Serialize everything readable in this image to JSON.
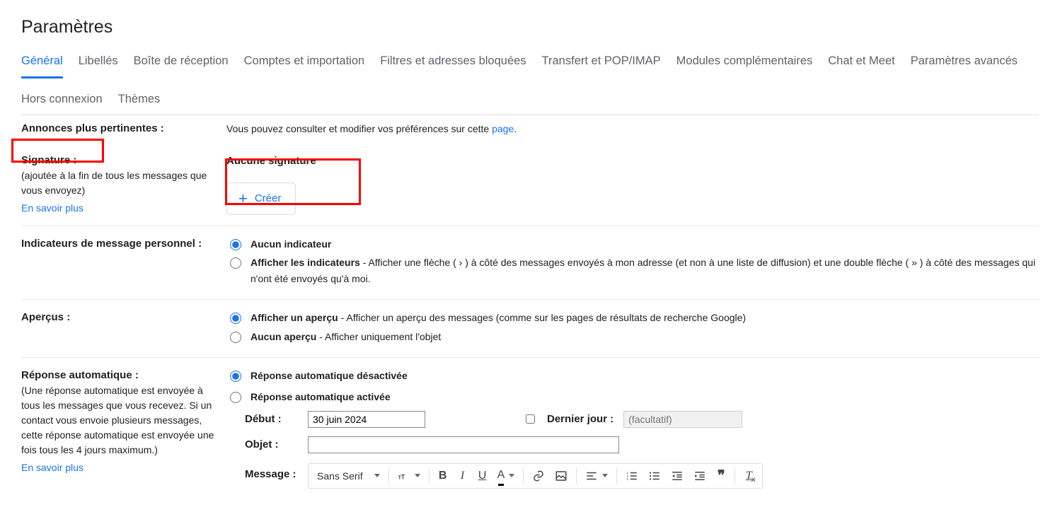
{
  "pageTitle": "Paramètres",
  "tabs": [
    "Général",
    "Libellés",
    "Boîte de réception",
    "Comptes et importation",
    "Filtres et adresses bloquées",
    "Transfert et POP/IMAP",
    "Modules complémentaires",
    "Chat et Meet",
    "Paramètres avancés",
    "Hors connexion",
    "Thèmes"
  ],
  "activeTabIndex": 0,
  "ads": {
    "label": "Annonces plus pertinentes :",
    "text": "Vous pouvez consulter et modifier vos préférences sur cette ",
    "link": "page",
    "suffix": "."
  },
  "signature": {
    "label": "Signature :",
    "desc": "(ajoutée à la fin de tous les messages que vous envoyez)",
    "learnMore": "En savoir plus",
    "none": "Aucune signature",
    "createBtn": "Créer"
  },
  "indicators": {
    "label": "Indicateurs de message personnel :",
    "opt1": "Aucun indicateur",
    "opt2bold": "Afficher les indicateurs",
    "opt2text": " - Afficher une flèche ( › ) à côté des messages envoyés à mon adresse (et non à une liste de diffusion) et une double flèche ( » ) à côté des messages qui n'ont été envoyés qu'à moi."
  },
  "snippets": {
    "label": "Aperçus :",
    "opt1bold": "Afficher un aperçu",
    "opt1text": " - Afficher un aperçu des messages (comme sur les pages de résultats de recherche Google)",
    "opt2bold": "Aucun aperçu",
    "opt2text": " - Afficher uniquement l'objet"
  },
  "vacation": {
    "label": "Réponse automatique :",
    "desc": "(Une réponse automatique est envoyée à tous les messages que vous recevez. Si un contact vous envoie plusieurs messages, cette réponse automatique est envoyée une fois tous les 4 jours maximum.)",
    "learnMore": "En savoir plus",
    "opt1": "Réponse automatique désactivée",
    "opt2": "Réponse automatique activée",
    "startLabel": "Début :",
    "startValue": "30 juin 2024",
    "lastDayLabel": "Dernier jour :",
    "lastDayPlaceholder": "(facultatif)",
    "subjectLabel": "Objet :",
    "subjectValue": "",
    "messageLabel": "Message :",
    "fontName": "Sans Serif"
  }
}
